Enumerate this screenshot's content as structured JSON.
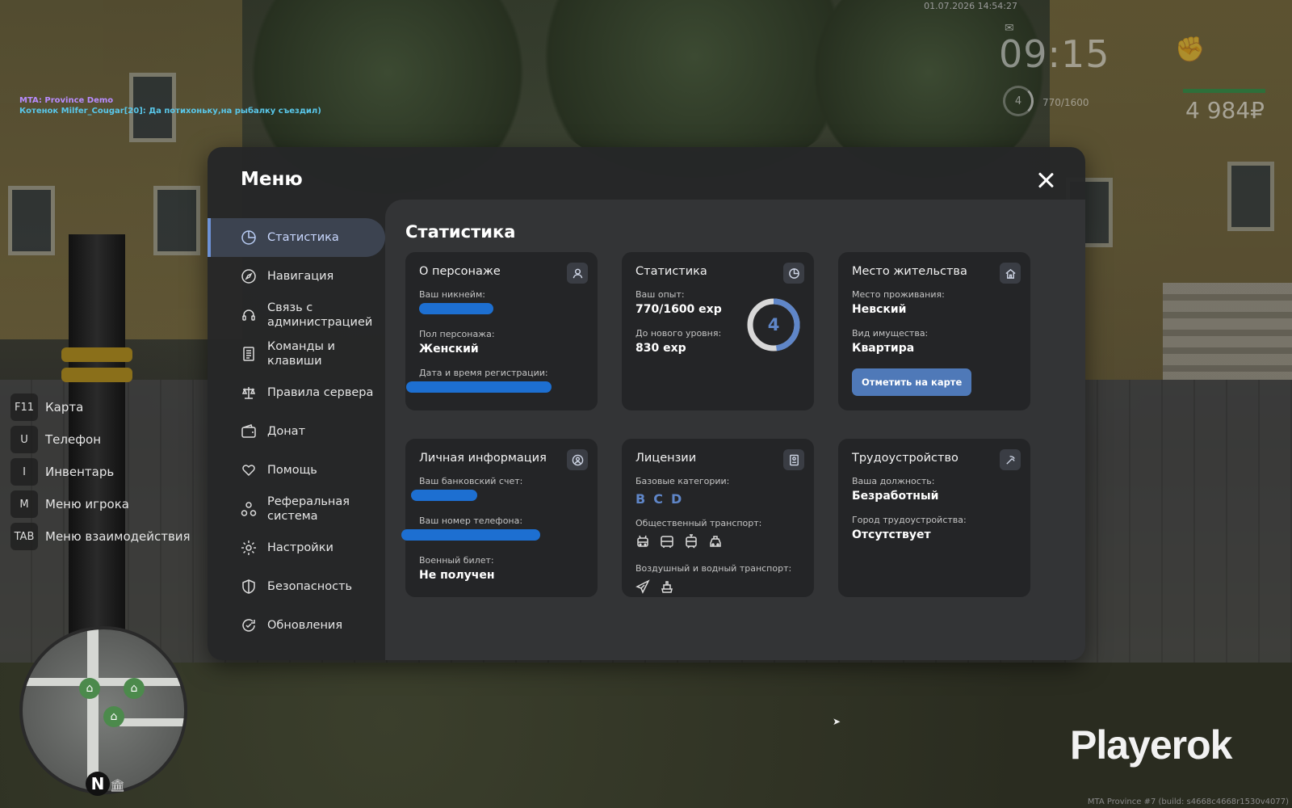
{
  "hud": {
    "datetime": "01.07.2026 14:54:27",
    "clock": "09:15",
    "level": "4",
    "exp": "770/1600",
    "money": "4 984₽",
    "icons": {
      "mail": "mail-icon",
      "fist": "fist-icon"
    }
  },
  "chat": [
    "MTA: Province Demo",
    "Котенок Milfer_Cougar[20]: Да потихоньку,на рыбалку съездил)"
  ],
  "keybinds": [
    {
      "key": "F11",
      "label": "Карта"
    },
    {
      "key": "U",
      "label": "Телефон"
    },
    {
      "key": "I",
      "label": "Инвентарь"
    },
    {
      "key": "M",
      "label": "Меню игрока"
    },
    {
      "key": "TAB",
      "label": "Меню взаимодействия"
    }
  ],
  "minimap": {
    "north": "N"
  },
  "watermark": "Playerok",
  "build": "MTA Province #7 (build: s4668c4668r1530v4077)",
  "menu": {
    "title": "Меню",
    "sidebar": [
      {
        "label": "Статистика",
        "icon": "pie-chart-icon",
        "active": true
      },
      {
        "label": "Навигация",
        "icon": "compass-icon"
      },
      {
        "label": "Связь с администрацией",
        "icon": "headset-icon"
      },
      {
        "label": "Команды и клавиши",
        "icon": "document-icon"
      },
      {
        "label": "Правила сервера",
        "icon": "scales-icon"
      },
      {
        "label": "Донат",
        "icon": "wallet-icon"
      },
      {
        "label": "Помощь",
        "icon": "heart-hands-icon"
      },
      {
        "label": "Реферальная система",
        "icon": "referral-icon"
      },
      {
        "label": "Настройки",
        "icon": "gear-icon"
      },
      {
        "label": "Безопасность",
        "icon": "shield-icon"
      },
      {
        "label": "Обновления",
        "icon": "refresh-check-icon"
      }
    ],
    "content_title": "Статистика",
    "cards": {
      "character": {
        "title": "О персонаже",
        "icon": "user-icon",
        "nickname_label": "Ваш никнейм:",
        "gender_label": "Пол персонажа:",
        "gender_value": "Женский",
        "regdate_label": "Дата и время регистрации:"
      },
      "stats": {
        "title": "Статистика",
        "icon": "pie-chart-icon",
        "exp_label": "Ваш опыт:",
        "exp_value": "770/1600 exp",
        "next_label": "До нового уровня:",
        "next_value": "830 exp",
        "level": "4",
        "progress": 0.48
      },
      "residence": {
        "title": "Место жительства",
        "icon": "house-icon",
        "place_label": "Место проживания:",
        "place_value": "Невский",
        "property_label": "Вид имущества:",
        "property_value": "Квартира",
        "map_button": "Отметить на карте"
      },
      "personal": {
        "title": "Личная информация",
        "icon": "person-circle-icon",
        "bank_label": "Ваш банковский счет:",
        "phone_label": "Ваш номер телефона:",
        "military_label": "Военный билет:",
        "military_value": "Не получен"
      },
      "licenses": {
        "title": "Лицензии",
        "icon": "id-card-icon",
        "basic_label": "Базовые категории:",
        "basic_categories": [
          "B",
          "C",
          "D"
        ],
        "public_label": "Общественный транспорт:",
        "public_icons": [
          "trolleybus-icon",
          "bus-icon",
          "tram-icon",
          "taxi-icon"
        ],
        "airwater_label": "Воздушный и водный транспорт:",
        "airwater_icons": [
          "plane-icon",
          "boat-icon"
        ]
      },
      "employment": {
        "title": "Трудоустройство",
        "icon": "pickaxe-icon",
        "position_label": "Ваша должность:",
        "position_value": "Безработный",
        "city_label": "Город трудоустройства:",
        "city_value": "Отсутствует"
      }
    }
  },
  "colors": {
    "accent": "#5f86c8",
    "button": "#4f79b8",
    "redact": "#1d6fd1",
    "active_bg": "#3c4350"
  }
}
